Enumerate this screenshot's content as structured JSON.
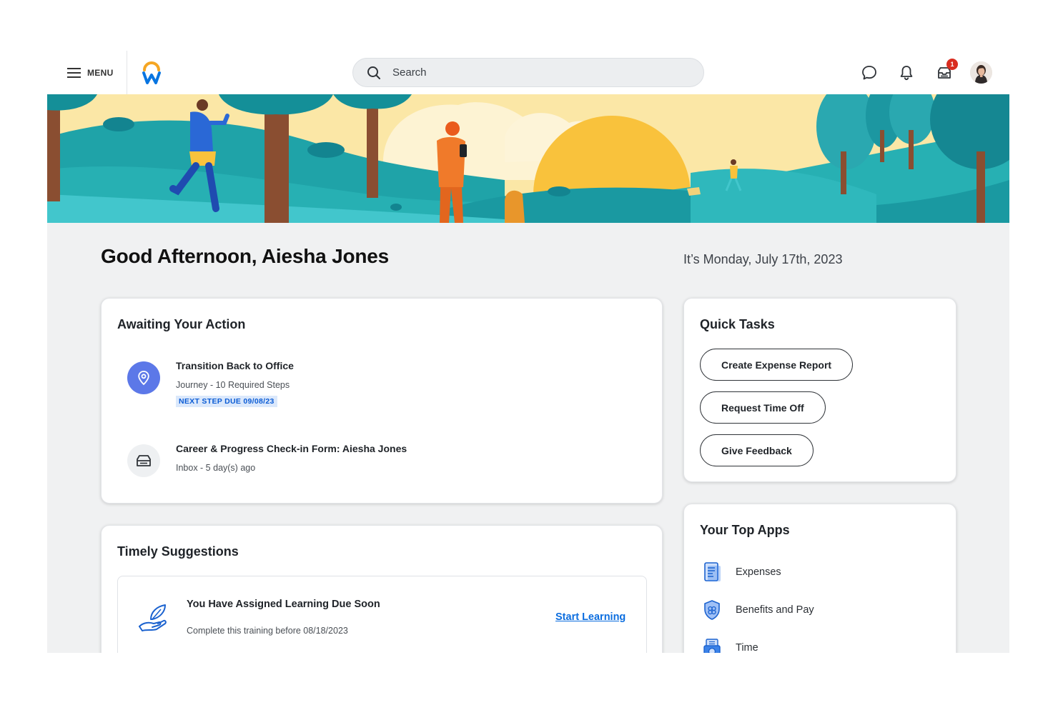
{
  "header": {
    "menu_label": "MENU",
    "search_placeholder": "Search",
    "notification_badge": "1"
  },
  "greeting": "Good Afternoon, Aiesha Jones",
  "date": "It’s Monday, July 17th, 2023",
  "awaiting_action": {
    "title": "Awaiting Your Action",
    "items": [
      {
        "title": "Transition Back to Office",
        "subtitle": "Journey - 10 Required Steps",
        "tag": "NEXT STEP DUE 09/08/23",
        "icon": "location-pin-icon"
      },
      {
        "title": "Career & Progress Check-in Form: Aiesha Jones",
        "subtitle": "Inbox - 5 day(s) ago",
        "icon": "inbox-tray-icon"
      }
    ]
  },
  "quick_tasks": {
    "title": "Quick Tasks",
    "buttons": [
      "Create Expense Report",
      "Request Time Off",
      "Give Feedback"
    ]
  },
  "top_apps": {
    "title": "Your Top Apps",
    "apps": [
      {
        "label": "Expenses",
        "icon": "receipt-icon"
      },
      {
        "label": "Benefits and Pay",
        "icon": "shield-icon"
      },
      {
        "label": "Time",
        "icon": "time-clock-icon"
      }
    ]
  },
  "timely_suggestions": {
    "title": "Timely Suggestions",
    "item": {
      "title": "You Have Assigned Learning Due Soon",
      "subtitle": "Complete this training before 08/18/2023",
      "link": "Start Learning",
      "icon": "hand-leaf-icon"
    }
  },
  "colors": {
    "accent_blue": "#0b6ddf",
    "workday_orange": "#f5a623",
    "workday_blue": "#0875e1",
    "pin_purple": "#5c78e8",
    "badge_red": "#d92d20"
  }
}
